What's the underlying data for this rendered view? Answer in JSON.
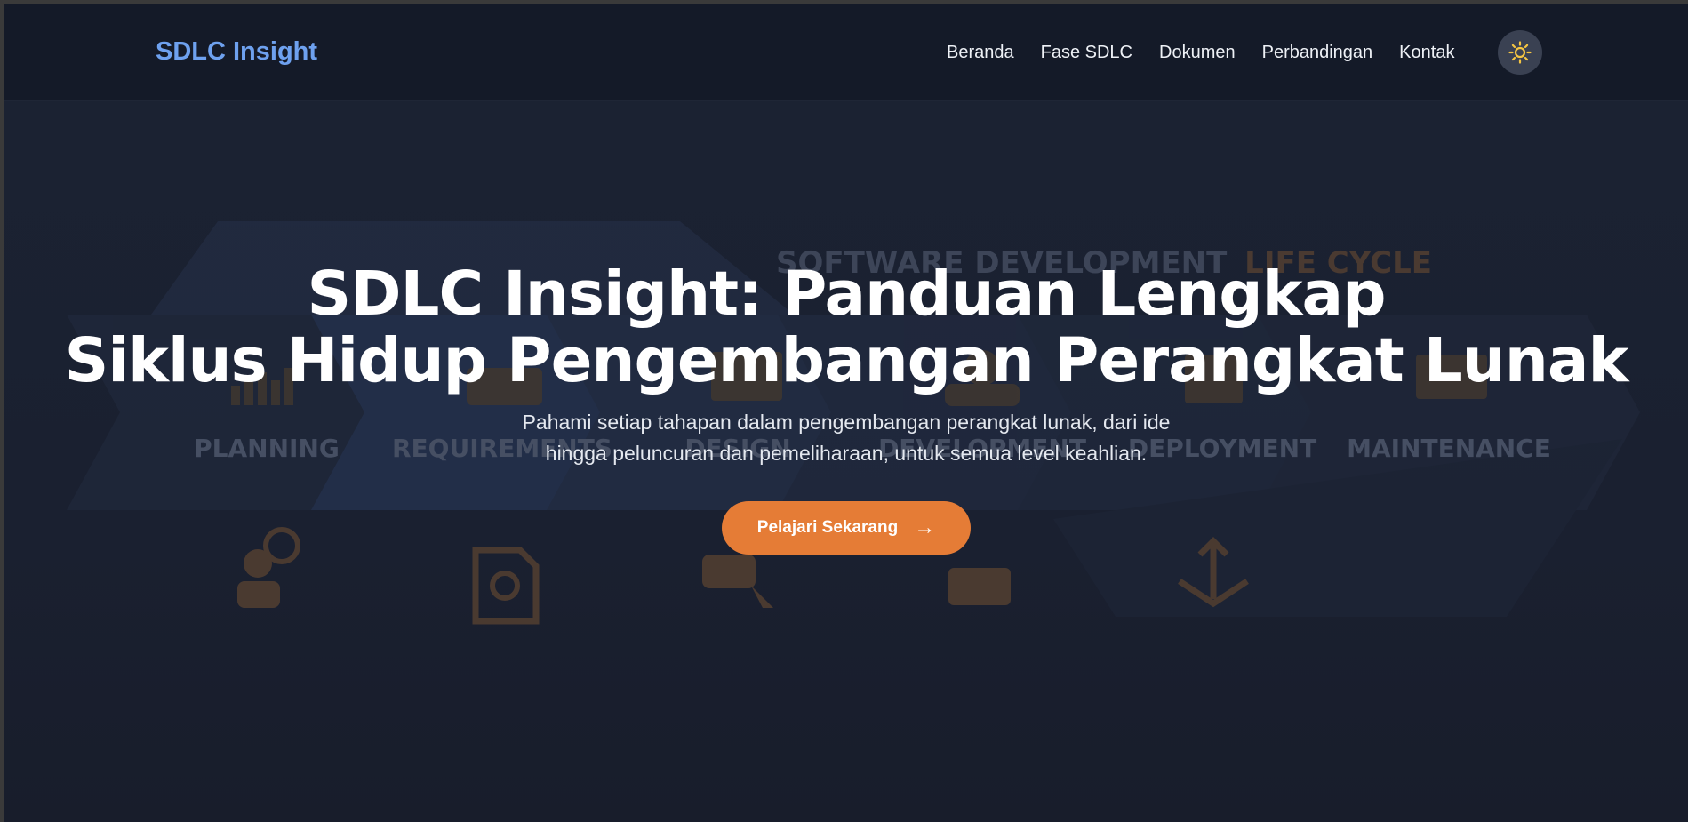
{
  "navbar": {
    "brand": "SDLC Insight",
    "links": [
      {
        "label": "Beranda"
      },
      {
        "label": "Fase SDLC"
      },
      {
        "label": "Dokumen"
      },
      {
        "label": "Perbandingan"
      },
      {
        "label": "Kontak"
      }
    ],
    "theme_toggle_icon": "sun-icon"
  },
  "background": {
    "heading_main": "SOFTWARE DEVELOPMENT",
    "heading_accent": "LIFE CYCLE",
    "phases": [
      "PLANNING",
      "REQUIREMENTS",
      "DESIGN",
      "DEVELOPMENT",
      "DEPLOYMENT",
      "MAINTENANCE"
    ]
  },
  "hero": {
    "title_line1": "SDLC Insight: Panduan Lengkap",
    "title_line2": "Siklus Hidup Pengembangan Perangkat Lunak",
    "subtitle_line1": "Pahami setiap tahapan dalam pengembangan perangkat lunak, dari ide",
    "subtitle_line2": "hingga peluncuran dan pemeliharaan, untuk semua level keahlian.",
    "cta_label": "Pelajari Sekarang",
    "cta_icon": "arrow-right-icon"
  },
  "colors": {
    "accent": "#e57c36",
    "brand": "#6ea1ef",
    "background": "#1a2030",
    "navbar": "#141a28"
  }
}
